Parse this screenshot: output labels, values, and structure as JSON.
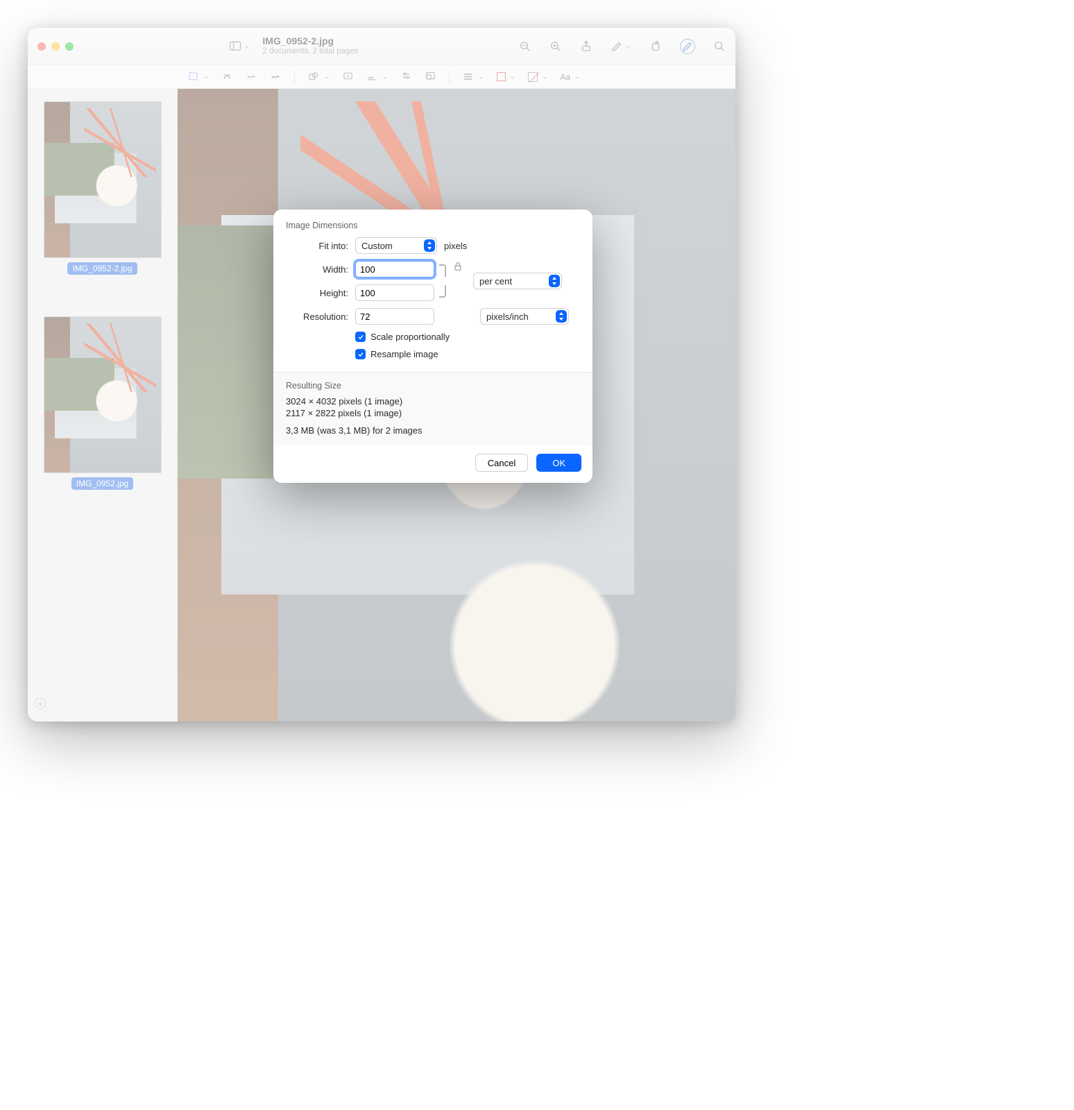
{
  "titlebar": {
    "filename": "IMG_0952-2.jpg",
    "subtitle": "2 documents, 2 total pages"
  },
  "sidebar": {
    "thumbs": [
      {
        "label": "IMG_0952-2.jpg"
      },
      {
        "label": "IMG_0952.jpg"
      }
    ]
  },
  "toolbar2": {
    "text_style": "Aa"
  },
  "dialog": {
    "section_title": "Image Dimensions",
    "fit_into_label": "Fit into:",
    "fit_into_value": "Custom",
    "fit_into_unit": "pixels",
    "width_label": "Width:",
    "width_value": "100",
    "height_label": "Height:",
    "height_value": "100",
    "wh_unit": "per cent",
    "resolution_label": "Resolution:",
    "resolution_value": "72",
    "resolution_unit": "pixels/inch",
    "scale_prop": "Scale proportionally",
    "resample": "Resample image",
    "resulting_title": "Resulting Size",
    "res_line1": "3024 × 4032 pixels (1 image)",
    "res_line2": "2117 × 2822 pixels (1 image)",
    "res_line3": "3,3 MB (was 3,1 MB) for 2 images",
    "cancel": "Cancel",
    "ok": "OK"
  }
}
